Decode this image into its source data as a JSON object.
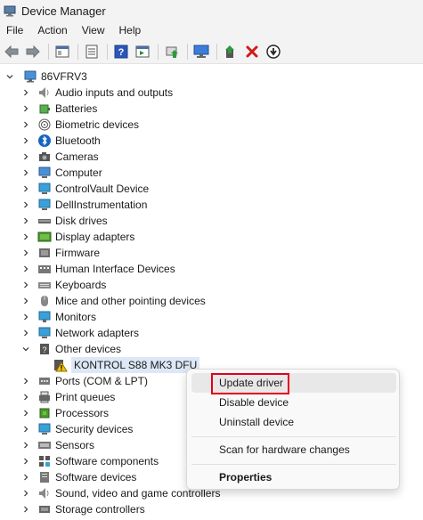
{
  "window": {
    "title": "Device Manager",
    "app_icon": "device-manager-icon"
  },
  "menu": [
    "File",
    "Action",
    "View",
    "Help"
  ],
  "toolbar": {
    "buttons": [
      "back-icon",
      "forward-icon",
      "show-hide-tree-icon",
      "properties-icon",
      "help-icon",
      "action-pane-icon",
      "update-driver-icon",
      "scan-hardware-icon",
      "enable-device-icon",
      "uninstall-device-icon",
      "download-driver-icon"
    ]
  },
  "tree": {
    "root": "86VFRV3",
    "categories": [
      "Audio inputs and outputs",
      "Batteries",
      "Biometric devices",
      "Bluetooth",
      "Cameras",
      "Computer",
      "ControlVault Device",
      "DellInstrumentation",
      "Disk drives",
      "Display adapters",
      "Firmware",
      "Human Interface Devices",
      "Keyboards",
      "Mice and other pointing devices",
      "Monitors",
      "Network adapters",
      "Other devices",
      "Ports (COM & LPT)",
      "Print queues",
      "Processors",
      "Security devices",
      "Sensors",
      "Software components",
      "Software devices",
      "Sound, video and game controllers",
      "Storage controllers"
    ],
    "other_devices_child": "KONTROL S88 MK3 DFU"
  },
  "context_menu": {
    "items": [
      "Update driver",
      "Disable device",
      "Uninstall device",
      "Scan for hardware changes",
      "Properties"
    ]
  },
  "colors": {
    "highlight": "#e3001b",
    "selection": "#dde8f6",
    "accent": "#0067c0"
  }
}
